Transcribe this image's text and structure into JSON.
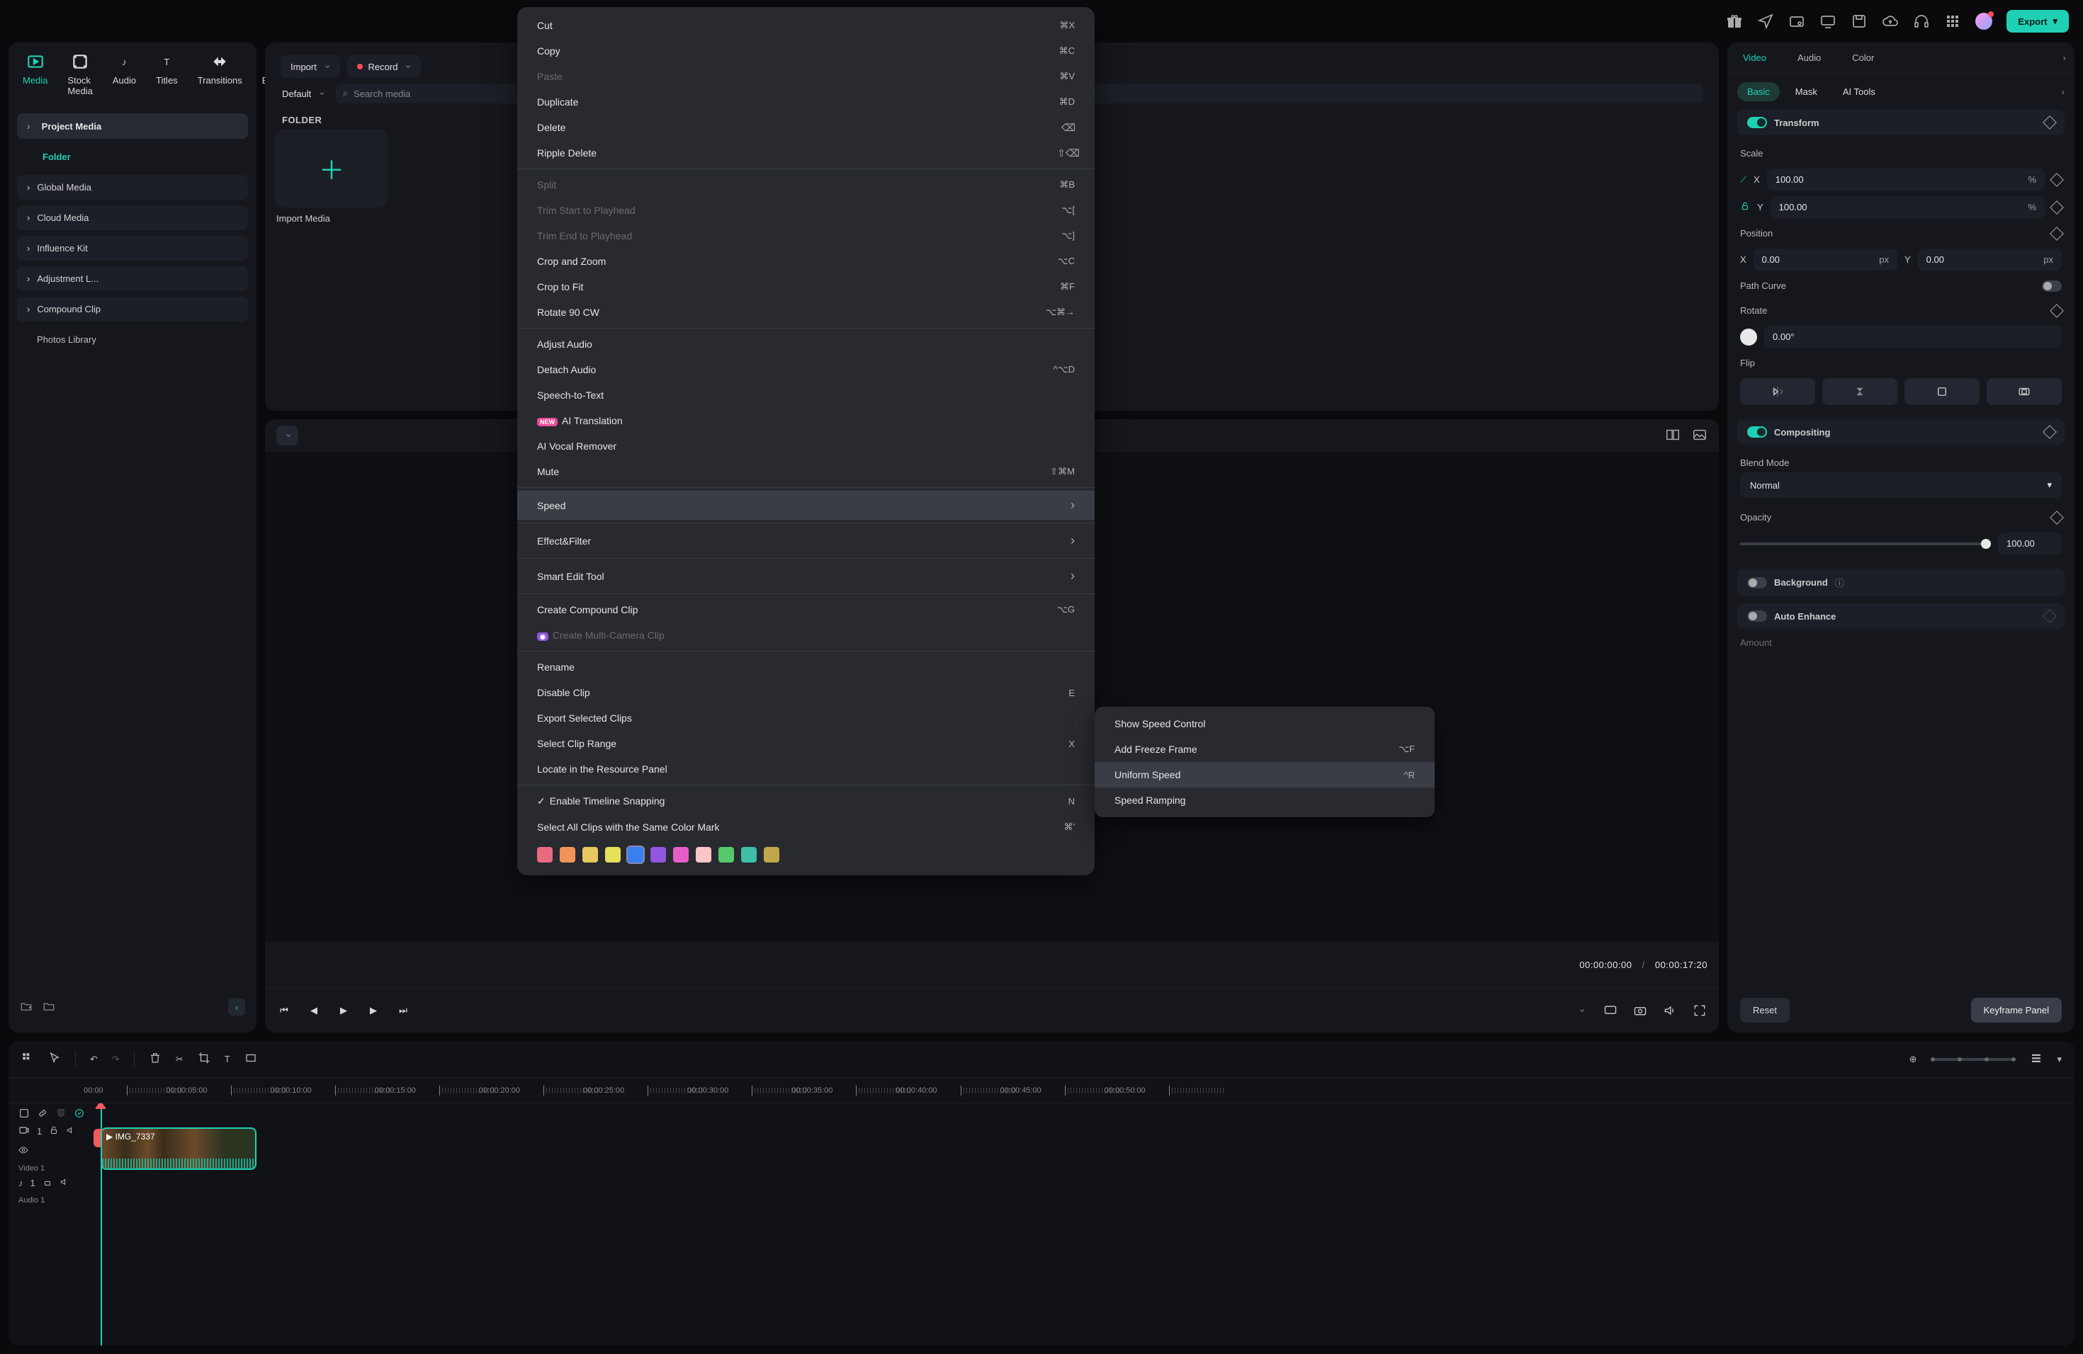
{
  "topbar": {
    "export_label": "Export"
  },
  "media_tabs": [
    "Media",
    "Stock Media",
    "Audio",
    "Titles",
    "Transitions",
    "Effects"
  ],
  "media_tabs_active_index": 0,
  "sidebar": {
    "project_media": "Project Media",
    "folder": "Folder",
    "items": [
      "Global Media",
      "Cloud Media",
      "Influence Kit",
      "Adjustment L...",
      "Compound Clip"
    ],
    "photos": "Photos Library"
  },
  "browse": {
    "import": "Import",
    "record": "Record",
    "default": "Default",
    "search_placeholder": "Search media",
    "folder_title": "FOLDER",
    "import_media_tile": "Import Media"
  },
  "preview": {
    "timecode_current": "00:00:00:00",
    "timecode_total": "00:00:17:20"
  },
  "inspector": {
    "tabs": [
      "Video",
      "Audio",
      "Color"
    ],
    "tabs_active": 0,
    "subtabs": [
      "Basic",
      "Mask",
      "AI Tools"
    ],
    "subtabs_active": 0,
    "transform_label": "Transform",
    "scale_label": "Scale",
    "scale_x": "100.00",
    "scale_y": "100.00",
    "position_label": "Position",
    "pos_x": "0.00",
    "pos_y": "0.00",
    "path_curve": "Path Curve",
    "rotate_label": "Rotate",
    "rotate_value": "0.00°",
    "flip_label": "Flip",
    "compositing_label": "Compositing",
    "blend_label": "Blend Mode",
    "blend_value": "Normal",
    "opacity_label": "Opacity",
    "opacity_value": "100.00",
    "background_label": "Background",
    "autoenhance_label": "Auto Enhance",
    "amount_label": "Amount",
    "reset": "Reset",
    "keyframe_panel": "Keyframe Panel",
    "unit_percent": "%",
    "unit_px": "px",
    "x_label": "X",
    "y_label": "Y"
  },
  "timeline": {
    "ruler": [
      "00:00",
      "00:00:05:00",
      "00:00:10:00",
      "00:00:15:00",
      "00:00:20:00",
      "00:00:25:00",
      "00:00:30:00",
      "00:00:35:00",
      "00:00:40:00",
      "00:00:45:00",
      "00:00:50:00"
    ],
    "video_track_label": "Video 1",
    "audio_track_label": "Audio 1",
    "track_index": "1",
    "clip_name": "IMG_7337"
  },
  "context_menu": {
    "items": [
      {
        "label": "Cut",
        "kbd": "⌘X"
      },
      {
        "label": "Copy",
        "kbd": "⌘C"
      },
      {
        "label": "Paste",
        "kbd": "⌘V",
        "disabled": true
      },
      {
        "label": "Duplicate",
        "kbd": "⌘D"
      },
      {
        "label": "Delete",
        "icon": "⌫"
      },
      {
        "label": "Ripple Delete",
        "icon": "⇧⌫"
      },
      {
        "sep": true
      },
      {
        "label": "Split",
        "kbd": "⌘B",
        "disabled": true
      },
      {
        "label": "Trim Start to Playhead",
        "kbd": "⌥[",
        "disabled": true
      },
      {
        "label": "Trim End to Playhead",
        "kbd": "⌥]",
        "disabled": true
      },
      {
        "label": "Crop and Zoom",
        "kbd": "⌥C"
      },
      {
        "label": "Crop to Fit",
        "kbd": "⌘F"
      },
      {
        "label": "Rotate 90 CW",
        "kbd": "⌥⌘→"
      },
      {
        "sep": true
      },
      {
        "label": "Adjust Audio"
      },
      {
        "label": "Detach Audio",
        "kbd": "^⌥D"
      },
      {
        "label": "Speech-to-Text"
      },
      {
        "label": "AI Translation",
        "badge": "NEW"
      },
      {
        "label": "AI Vocal Remover"
      },
      {
        "label": "Mute",
        "kbd": "⇧⌘M"
      },
      {
        "sep": true
      },
      {
        "label": "Speed",
        "submenu": true,
        "highlight": true
      },
      {
        "sep": true
      },
      {
        "label": "Effect&Filter",
        "submenu": true
      },
      {
        "sep": true
      },
      {
        "label": "Smart Edit Tool",
        "submenu": true
      },
      {
        "sep": true
      },
      {
        "label": "Create Compound Clip",
        "kbd": "⌥G"
      },
      {
        "label": "Create Multi-Camera Clip",
        "disabled": true,
        "badge_icon": true
      },
      {
        "sep": true
      },
      {
        "label": "Rename"
      },
      {
        "label": "Disable Clip",
        "kbd": "E"
      },
      {
        "label": "Export Selected Clips"
      },
      {
        "label": "Select Clip Range",
        "kbd": "X"
      },
      {
        "label": "Locate in the Resource Panel"
      },
      {
        "sep": true
      },
      {
        "label": "Enable Timeline Snapping",
        "kbd": "N",
        "check": true
      },
      {
        "label": "Select All Clips with the Same Color Mark",
        "kbd": "⌘'"
      }
    ],
    "swatches": [
      "#e86b7f",
      "#f29457",
      "#e8c95e",
      "#e8e05a",
      "#3a7ff0",
      "#9256e0",
      "#e65dc8",
      "#f9c5c5",
      "#55c96a",
      "#3ebfa6",
      "#c0a74a"
    ],
    "selected_swatch": 4
  },
  "speed_submenu": [
    {
      "label": "Show Speed Control"
    },
    {
      "label": "Add Freeze Frame",
      "kbd": "⌥F"
    },
    {
      "label": "Uniform Speed",
      "kbd": "^R",
      "highlight": true
    },
    {
      "label": "Speed Ramping"
    }
  ]
}
